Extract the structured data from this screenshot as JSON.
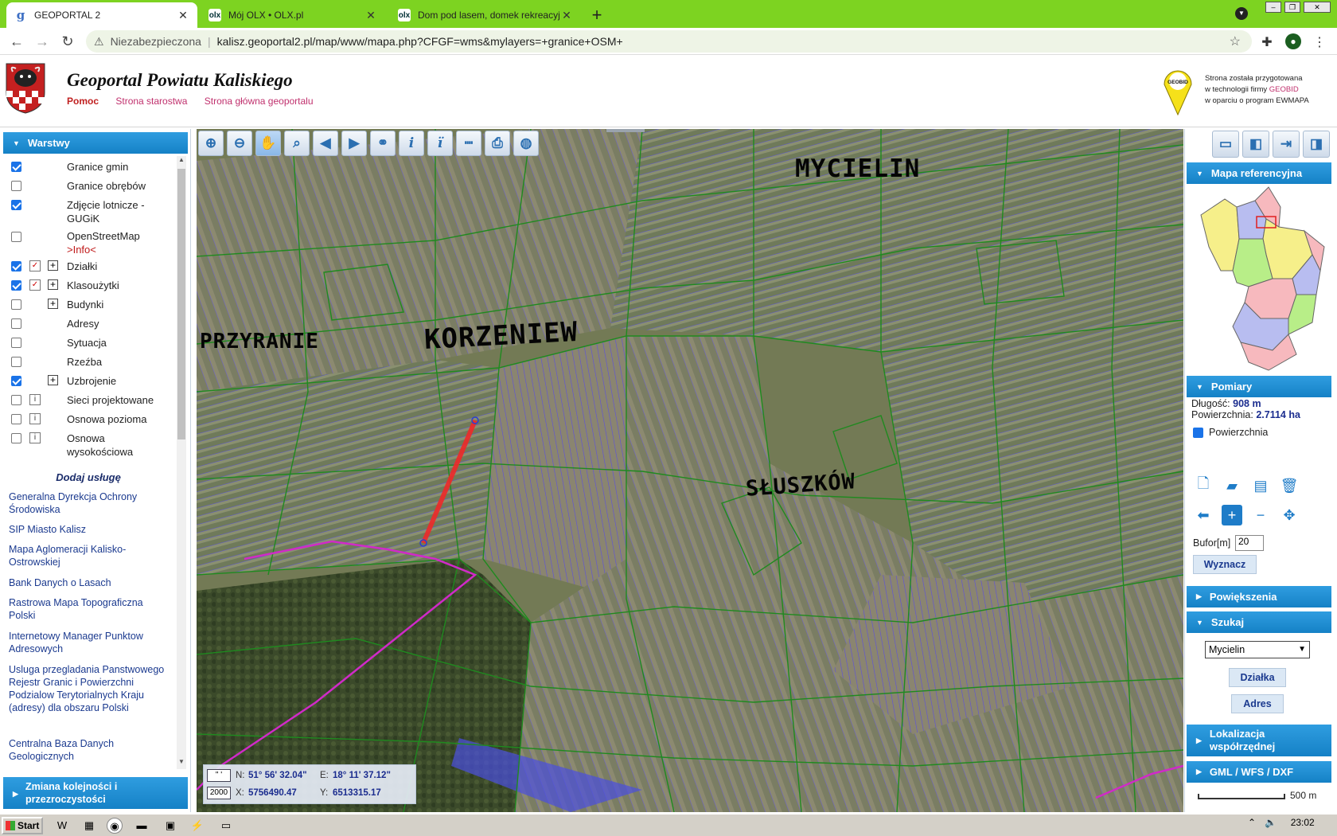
{
  "browser": {
    "tabs": [
      {
        "title": "GEOPORTAL 2",
        "favicon": "g"
      },
      {
        "title": "Mój OLX • OLX.pl",
        "favicon": "olx"
      },
      {
        "title": "Dom pod lasem, domek rekreacyjny",
        "favicon": "olx"
      }
    ],
    "insecure_label": "Niezabezpieczona",
    "url": "kalisz.geoportal2.pl/map/www/mapa.php?CFGF=wms&mylayers=+granice+OSM+"
  },
  "header": {
    "title": "Geoportal Powiatu Kaliskiego",
    "links": [
      "Pomoc",
      "Strona starostwa",
      "Strona główna geoportalu"
    ],
    "geobid_badge": "GEOBID",
    "geobid_line1": "Strona została przygotowana",
    "geobid_line2a": "w technologii firmy ",
    "geobid_line2b": "GEOBID",
    "geobid_line3": "w oparciu o program EWMAPA"
  },
  "layers_panel": {
    "title": "Warstwy",
    "layers": [
      {
        "label": "Granice gmin",
        "checked": true
      },
      {
        "label": "Granice obrębów",
        "checked": false
      },
      {
        "label": "Zdjęcie lotnicze - GUGiK",
        "checked": true
      },
      {
        "label": "OpenStreetMap",
        "info": ">Info<",
        "checked": false
      },
      {
        "label": "Działki",
        "checked": true
      },
      {
        "label": "Klasoużytki",
        "checked": true
      },
      {
        "label": "Budynki",
        "checked": false
      },
      {
        "label": "Adresy",
        "checked": false
      },
      {
        "label": "Sytuacja",
        "checked": false
      },
      {
        "label": "Rzeźba",
        "checked": false
      },
      {
        "label": "Uzbrojenie",
        "checked": true
      },
      {
        "label": "Sieci projektowane",
        "checked": false
      },
      {
        "label": "Osnowa pozioma",
        "checked": false
      },
      {
        "label": "Osnowa wysokościowa",
        "checked": false
      }
    ],
    "add_service": "Dodaj usługę",
    "services": [
      "Generalna Dyrekcja Ochrony Środowiska",
      "SIP Miasto Kalisz",
      "Mapa Aglomeracji Kalisko-Ostrowskiej",
      "Bank Danych o Lasach",
      "Rastrowa Mapa Topograficzna Polski",
      "Internetowy Manager Punktow Adresowych",
      "Usluga przegladania Panstwowego Rejestr Granic i Powierzchni Podzialow Terytorialnych Kraju (adresy) dla obszaru Polski",
      "Centralna Baza Danych Geologicznych"
    ],
    "reorder": "Zmiana kolejności i przezroczystości"
  },
  "map": {
    "annotations": [
      "MYCIELIN",
      "PRZYRANIE",
      "KORZENIEW",
      "SŁUSZKÓW"
    ],
    "coords": {
      "mini1": "\" '",
      "mini2": "2000",
      "n_key": "N:",
      "n_val": "51° 56' 32.04\"",
      "e_key": "E:",
      "e_val": "18° 11' 37.12\"",
      "x_key": "X:",
      "x_val": "5756490.47",
      "y_key": "Y:",
      "y_val": "6513315.17"
    }
  },
  "right_panel": {
    "ref_map_title": "Mapa referencyjna",
    "measure_title": "Pomiary",
    "length_label": "Długość:",
    "length_value": "908 m",
    "area_label": "Powierzchnia:",
    "area_value": "2.7114 ha",
    "area_checkbox": "Powierzchnia",
    "buffer_label": "Bufor[m]",
    "buffer_value": "20",
    "determine_button": "Wyznacz",
    "zoom_title": "Powiększenia",
    "search_title": "Szukaj",
    "search_select": "Mycielin",
    "parcel_button": "Działka",
    "address_button": "Adres",
    "locate_title": "Lokalizacja współrzędnej",
    "export_title": "GML / WFS / DXF",
    "scale_label": "500 m"
  },
  "taskbar": {
    "start": "Start",
    "clock": "23:02"
  }
}
